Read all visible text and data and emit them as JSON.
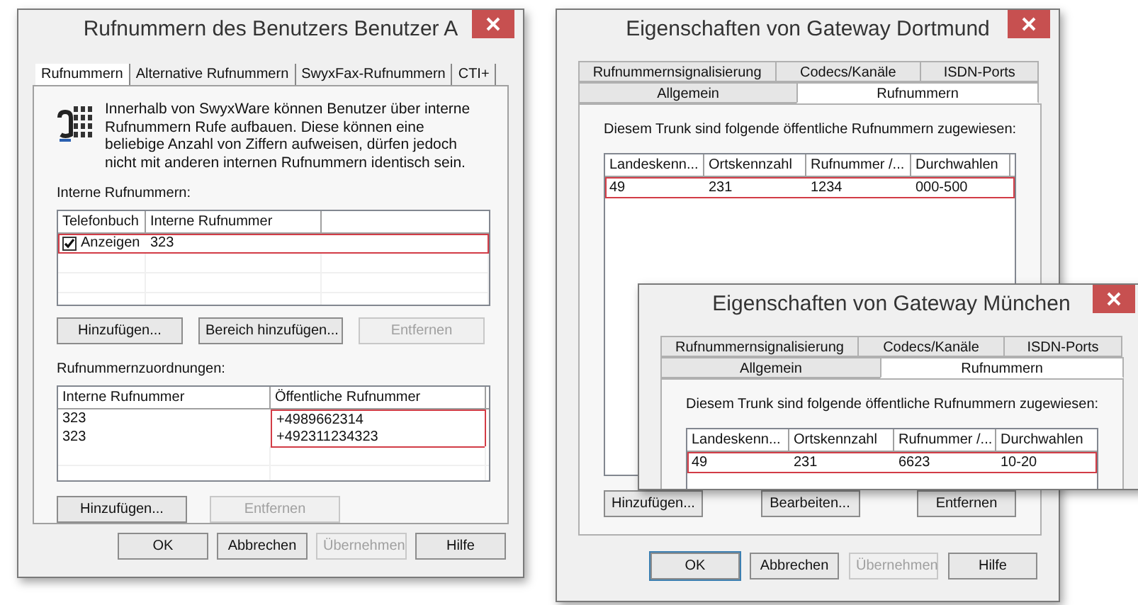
{
  "user_dialog": {
    "title": "Rufnummern des Benutzers Benutzer A",
    "tabs": [
      {
        "label": "Rufnummern",
        "selected": true
      },
      {
        "label": "Alternative Rufnummern",
        "selected": false
      },
      {
        "label": "SwyxFax-Rufnummern",
        "selected": false
      },
      {
        "label": "CTI+",
        "selected": false
      }
    ],
    "description": "Innerhalb von SwyxWare können Benutzer über interne Rufnummern Rufe aufbauen. Diese können eine beliebige Anzahl von Ziffern aufweisen, dürfen jedoch nicht mit anderen internen Rufnummern identisch sein.",
    "internal_label": "Interne Rufnummern:",
    "internal_table": {
      "columns": [
        "Telefonbuch",
        "Interne Rufnummer"
      ],
      "rows": [
        {
          "phonebook": "Anzeigen",
          "checked": true,
          "number": "323",
          "highlighted": true
        }
      ]
    },
    "internal_buttons": [
      {
        "label": "Hinzufügen...",
        "disabled": false
      },
      {
        "label": "Bereich hinzufügen...",
        "disabled": false
      },
      {
        "label": "Entfernen",
        "disabled": true
      }
    ],
    "mapping_label": "Rufnummernzuordnungen:",
    "mapping_table": {
      "columns": [
        "Interne Rufnummer",
        "Öffentliche Rufnummer"
      ],
      "rows": [
        {
          "internal": "323",
          "public": "+4989662314",
          "highlighted": true
        },
        {
          "internal": "323",
          "public": "+492311234323",
          "highlighted": true
        }
      ]
    },
    "mapping_buttons": [
      {
        "label": "Hinzufügen...",
        "disabled": false
      },
      {
        "label": "Entfernen",
        "disabled": true
      }
    ],
    "buttons": [
      {
        "label": "OK",
        "disabled": false
      },
      {
        "label": "Abbrechen",
        "disabled": false
      },
      {
        "label": "Übernehmen",
        "disabled": true
      },
      {
        "label": "Hilfe",
        "disabled": false
      }
    ]
  },
  "gateway_dialogs": [
    {
      "title": "Eigenschaften von Gateway Dortmund",
      "tab_rows": [
        [
          {
            "label": "Rufnummernsignalisierung",
            "selected": false
          },
          {
            "label": "Codecs/Kanäle",
            "selected": false
          },
          {
            "label": "ISDN-Ports",
            "selected": false
          }
        ],
        [
          {
            "label": "Allgemein",
            "selected": false
          },
          {
            "label": "Rufnummern",
            "selected": true
          }
        ]
      ],
      "description": "Diesem Trunk sind folgende öffentliche Rufnummern zugewiesen:",
      "table": {
        "columns": [
          "Landeskenn...",
          "Ortskennzahl",
          "Rufnummer /...",
          "Durchwahlen"
        ],
        "rows": [
          {
            "cells": [
              "49",
              "231",
              "1234",
              "000-500"
            ],
            "highlighted": true
          }
        ]
      },
      "table_buttons": [
        {
          "label": "Hinzufügen...",
          "disabled": false
        },
        {
          "label": "Bearbeiten...",
          "disabled": false
        },
        {
          "label": "Entfernen",
          "disabled": false
        }
      ],
      "buttons": [
        {
          "label": "OK",
          "disabled": false,
          "default": true
        },
        {
          "label": "Abbrechen",
          "disabled": false,
          "default": false
        },
        {
          "label": "Übernehmen",
          "disabled": true,
          "default": false
        },
        {
          "label": "Hilfe",
          "disabled": false,
          "default": false
        }
      ]
    },
    {
      "title": "Eigenschaften von Gateway München",
      "tab_rows": [
        [
          {
            "label": "Rufnummernsignalisierung",
            "selected": false
          },
          {
            "label": "Codecs/Kanäle",
            "selected": false
          },
          {
            "label": "ISDN-Ports",
            "selected": false
          }
        ],
        [
          {
            "label": "Allgemein",
            "selected": false
          },
          {
            "label": "Rufnummern",
            "selected": true
          }
        ]
      ],
      "description": "Diesem Trunk sind folgende öffentliche Rufnummern zugewiesen:",
      "table": {
        "columns": [
          "Landeskenn...",
          "Ortskennzahl",
          "Rufnummer /...",
          "Durchwahlen"
        ],
        "rows": [
          {
            "cells": [
              "49",
              "231",
              "6623",
              "10-20"
            ],
            "highlighted": true
          }
        ]
      }
    }
  ]
}
